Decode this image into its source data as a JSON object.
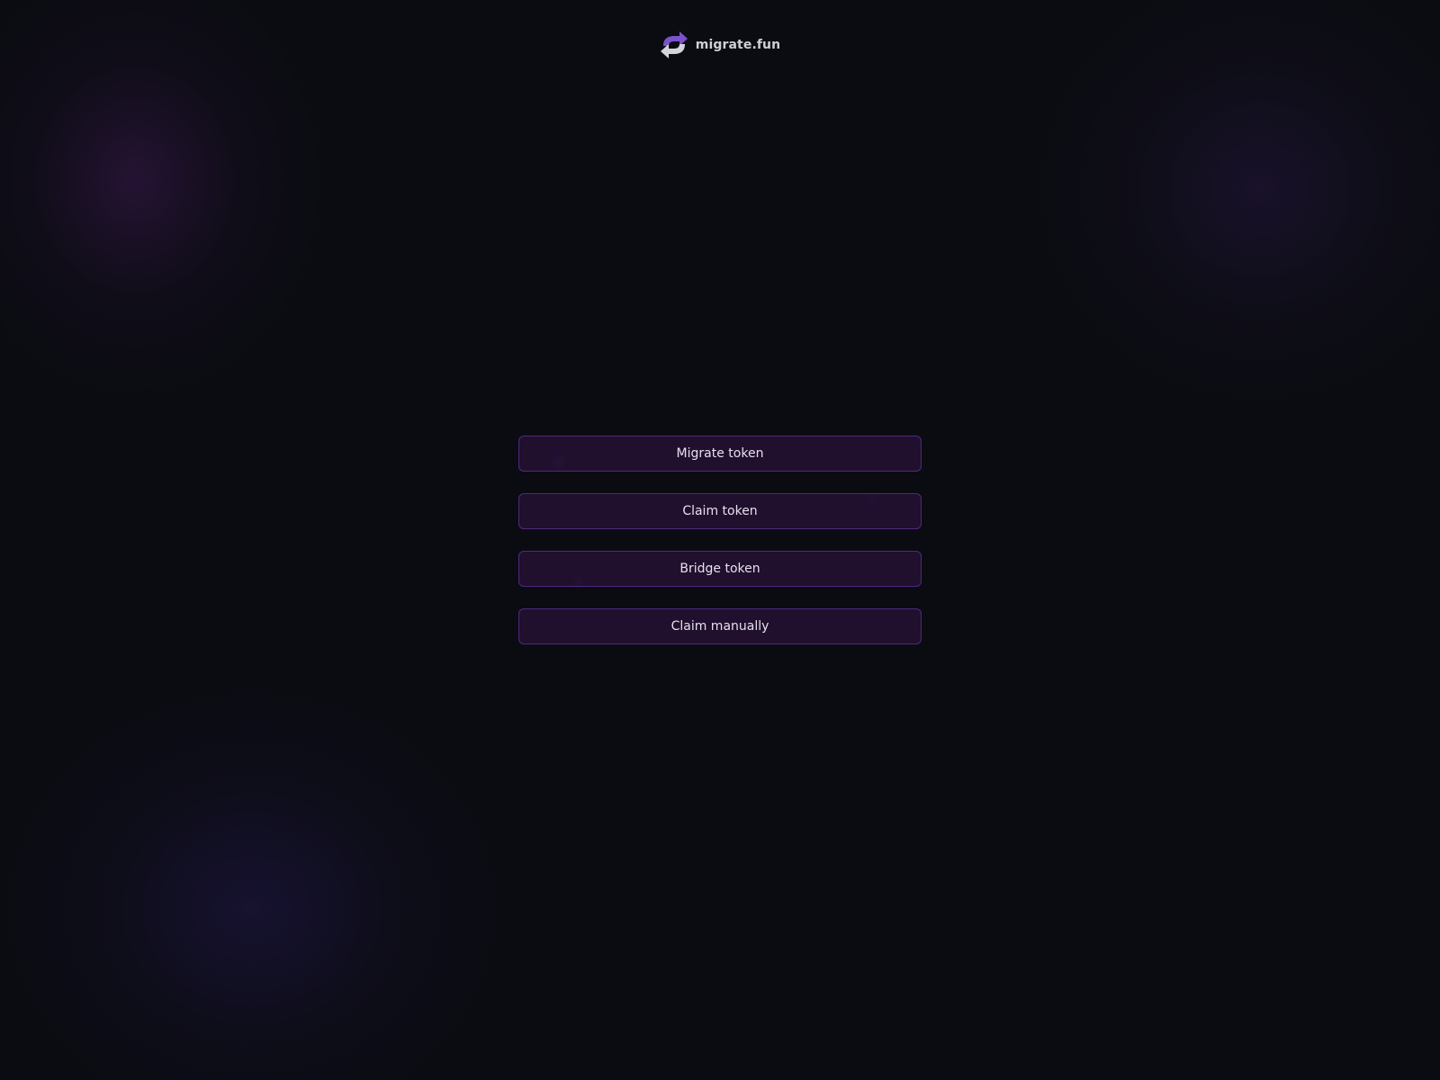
{
  "header": {
    "brand": "migrate.fun",
    "logo_icon": "refresh-arrows-icon",
    "accent_color": "#7b52c9",
    "secondary_color": "#d4d4dc"
  },
  "menu": {
    "items": [
      {
        "label": "Migrate token"
      },
      {
        "label": "Claim token"
      },
      {
        "label": "Bridge token"
      },
      {
        "label": "Claim manually"
      }
    ]
  },
  "theme": {
    "background": "#0b0c12",
    "button_background": "#24103280",
    "button_border": "#4e2a7e",
    "button_text": "#e6e0ee"
  }
}
